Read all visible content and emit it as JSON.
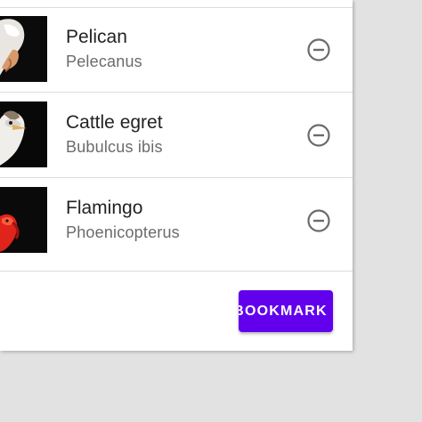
{
  "list": {
    "items": [
      {
        "name": "Pelican",
        "scientific": "Pelecanus",
        "thumb": "pelican-photo",
        "action_icon": "remove-circle-outline-icon"
      },
      {
        "name": "Cattle egret",
        "scientific": "Bubulcus ibis",
        "thumb": "cattle-egret-photo",
        "action_icon": "remove-circle-outline-icon"
      },
      {
        "name": "Flamingo",
        "scientific": "Phoenicopterus",
        "thumb": "flamingo-photo",
        "action_icon": "remove-circle-outline-icon"
      }
    ]
  },
  "actions": {
    "bookmark_label": "BOOKMARK"
  },
  "colors": {
    "primary": "#6200ee",
    "icon": "#6b6b6b",
    "divider": "#dcdcdc",
    "background": "#e2e2e2"
  }
}
